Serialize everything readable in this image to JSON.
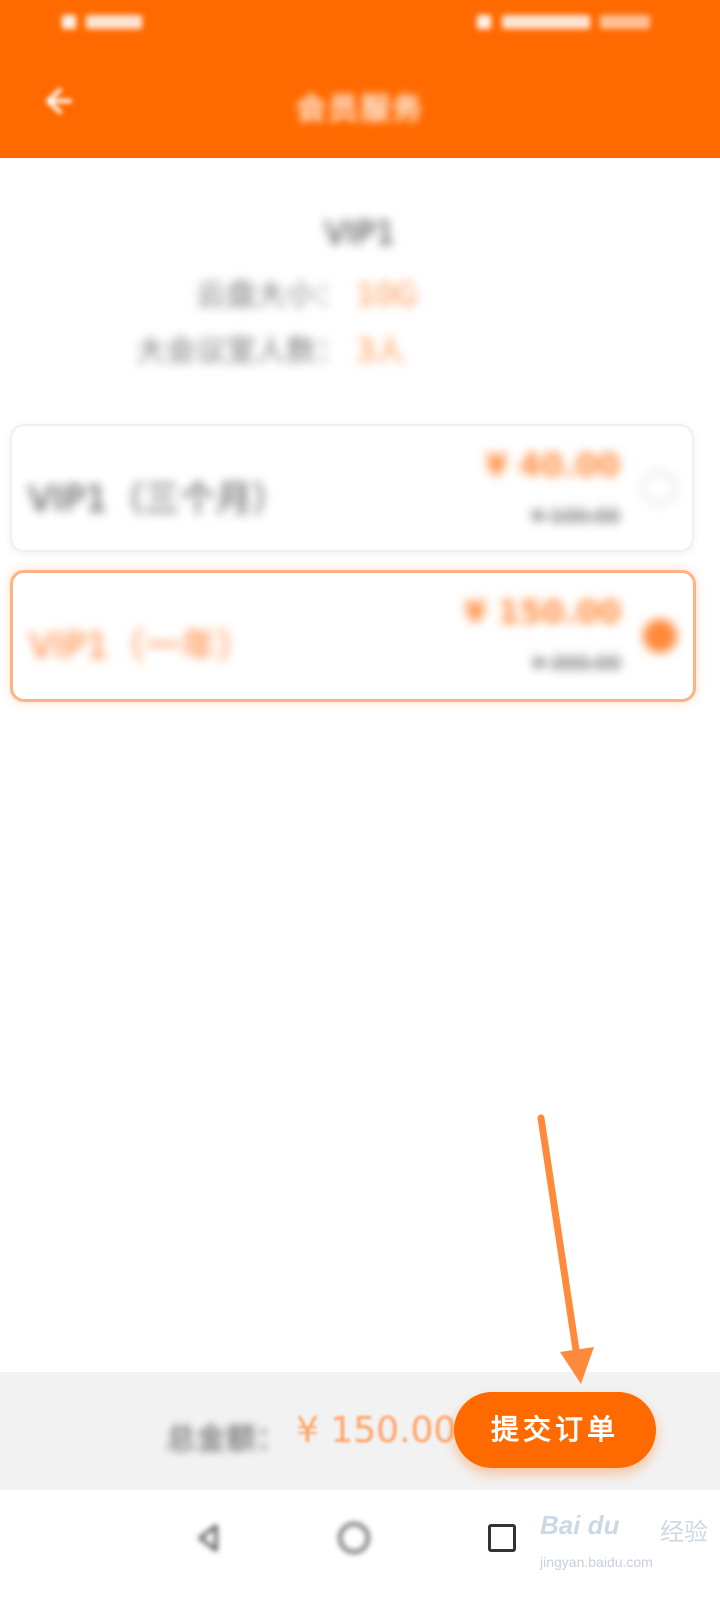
{
  "status_bar": {
    "left_text": "",
    "right_text": ""
  },
  "header": {
    "title": "会员服务"
  },
  "vip_info": {
    "name": "VIP1",
    "row1_label": "云盘大小：",
    "row1_value": "10G",
    "row2_label": "大会议室人数：",
    "row2_value": "3人"
  },
  "plans": [
    {
      "name": "VIP1（三个月）",
      "price": "¥ 40.00",
      "original": "¥ 100.00",
      "selected": false
    },
    {
      "name": "VIP1（一年）",
      "price": "¥ 150.00",
      "original": "¥ 300.00",
      "selected": true
    }
  ],
  "bottom_bar": {
    "total_label": "总金额：",
    "total_price": "¥ 150.00",
    "submit_label": "提交订单"
  },
  "watermark": {
    "brand": "Bai du",
    "brand_suffix": "经验",
    "domain": "jingyan.baidu.com"
  },
  "colors": {
    "brand": "#ff6a00",
    "accent": "#ff8a3c",
    "arrow": "#ff8a3c"
  }
}
